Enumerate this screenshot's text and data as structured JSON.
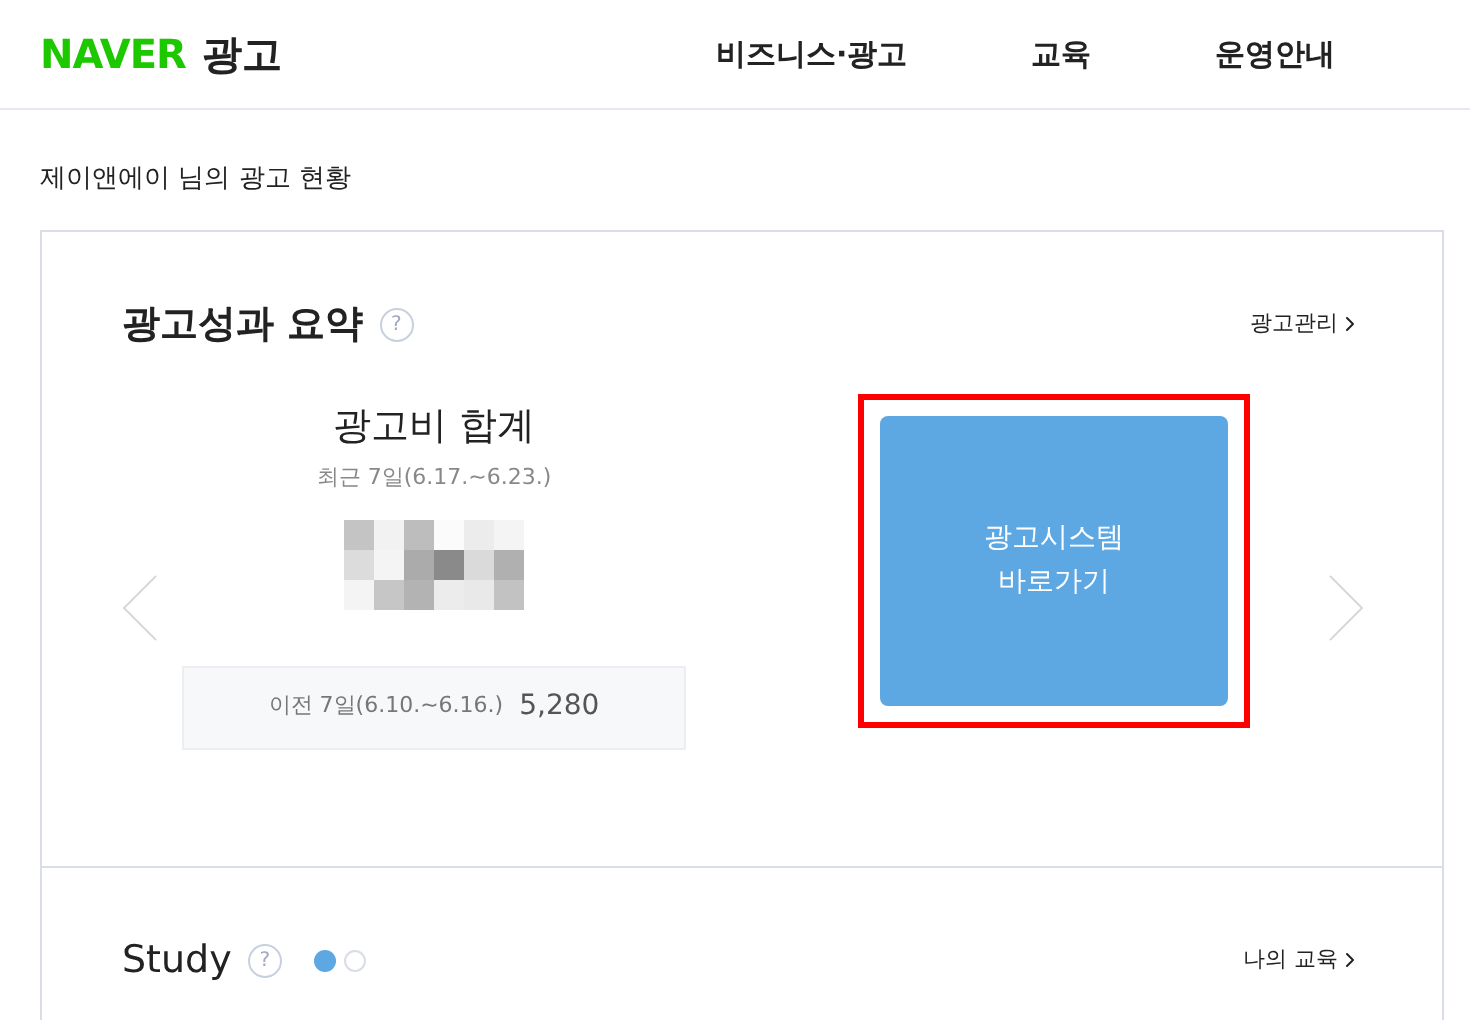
{
  "header": {
    "logo": "NAVER",
    "logo_suffix": "광고",
    "nav": [
      "비즈니스·광고",
      "교육",
      "운영안내"
    ]
  },
  "greeting": "제이앤에이 님의 광고 현황",
  "summary": {
    "title": "광고성과 요약",
    "help": "?",
    "link": "광고관리",
    "metric_title": "광고비 합계",
    "period": "최근 7일(6.17.~6.23.)",
    "previous_label": "이전 7일(6.10.~6.16.)",
    "previous_value": "5,280",
    "button_lines": [
      "광고시스템",
      "바로가기"
    ],
    "highlighted": true
  },
  "study": {
    "title": "Study",
    "help": "?",
    "link": "나의 교육",
    "dots": [
      {
        "selected": true
      },
      {
        "selected": false
      }
    ]
  }
}
